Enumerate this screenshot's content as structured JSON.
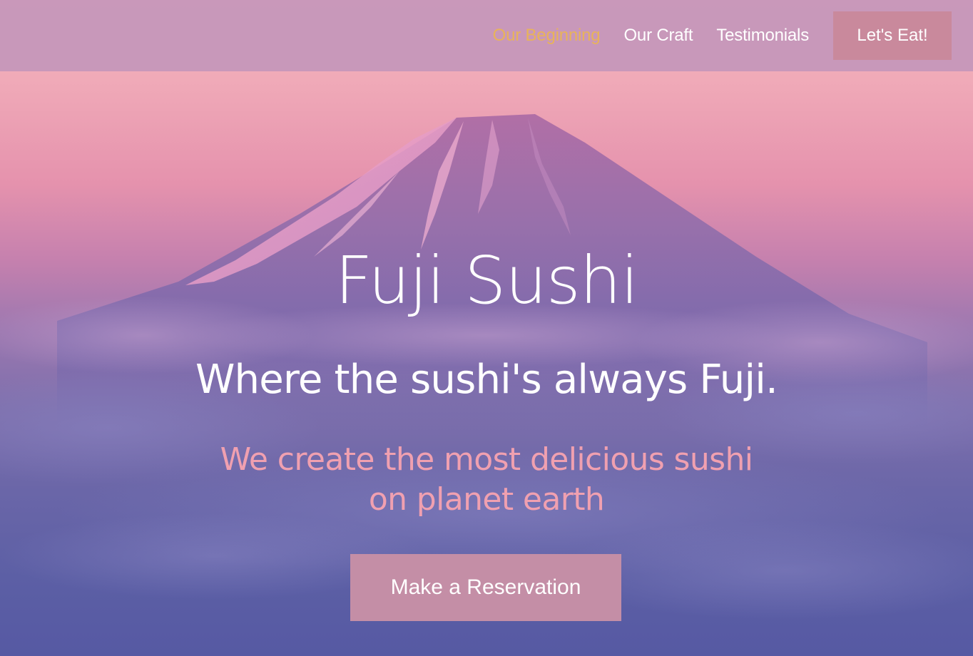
{
  "nav": {
    "links": [
      {
        "label": "Our Beginning",
        "active": true
      },
      {
        "label": "Our Craft",
        "active": false
      },
      {
        "label": "Testimonials",
        "active": false
      }
    ],
    "cta_label": "Let's Eat!"
  },
  "hero": {
    "title": "Fuji Sushi",
    "tagline": "Where the sushi's always Fuji.",
    "subline": "We create the most delicious sushi on planet earth",
    "button_label": "Make a Reservation",
    "background_image": "mount-fuji-sunset"
  },
  "colors": {
    "nav_bg": "#c496ba",
    "nav_active": "#e8b35a",
    "cta_bg": "#c9899c",
    "subline": "#f0a0b0",
    "button_bg": "#c48ea6"
  }
}
